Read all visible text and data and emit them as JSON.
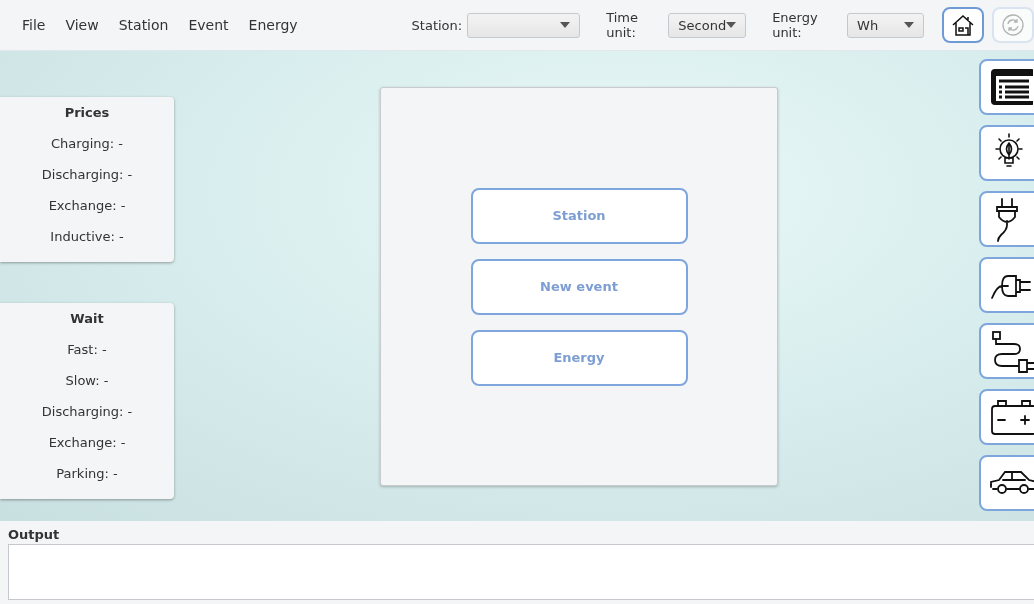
{
  "menu": [
    "File",
    "View",
    "Station",
    "Event",
    "Energy"
  ],
  "selectors": [
    {
      "label": "Station:"
    },
    {
      "label": "Time unit:",
      "value": "Second"
    },
    {
      "label": "Energy unit:",
      "value": "Wh"
    }
  ],
  "toolbar_buttons": [
    {
      "disabled": false
    },
    {
      "disabled": true
    }
  ],
  "panels": [
    {
      "title": "Prices",
      "rows": [
        "Charging: -",
        "Discharging: -",
        "Exchange: -",
        "Inductive: -"
      ]
    },
    {
      "title": "Wait",
      "rows": [
        "Fast: -",
        "Slow: -",
        "Discharging: -",
        "Exchange: -",
        "Parking: -"
      ]
    }
  ],
  "center_buttons": [
    "Station",
    "New event",
    "Energy"
  ],
  "output": {
    "label": "Output"
  }
}
